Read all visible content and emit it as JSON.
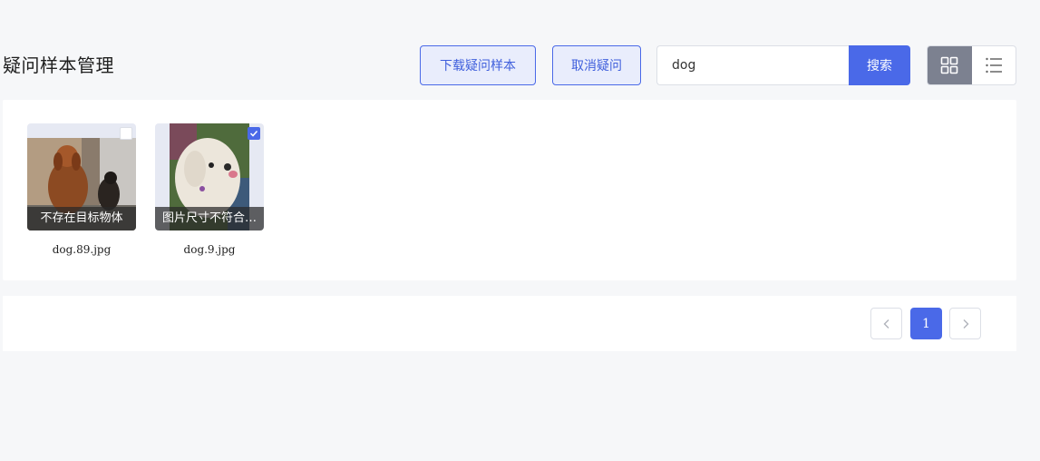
{
  "header": {
    "title": "疑问样本管理",
    "download_label": "下载疑问样本",
    "cancel_label": "取消疑问"
  },
  "search": {
    "value": "dog",
    "button_label": "搜索"
  },
  "view_toggle": {
    "active": "grid",
    "grid_icon": "grid-icon",
    "list_icon": "list-icon"
  },
  "samples": [
    {
      "filename": "dog.89.jpg",
      "tag": "不存在目标物体",
      "checked": false
    },
    {
      "filename": "dog.9.jpg",
      "tag": "图片尺寸不符合…",
      "checked": true
    }
  ],
  "pagination": {
    "current_page": "1",
    "prev_icon": "chevron-left-icon",
    "next_icon": "chevron-right-icon"
  },
  "colors": {
    "primary": "#4a69e8",
    "primary_light": "#e9edfc",
    "active_toggle": "#7c8190",
    "background": "#f6f7f9"
  }
}
